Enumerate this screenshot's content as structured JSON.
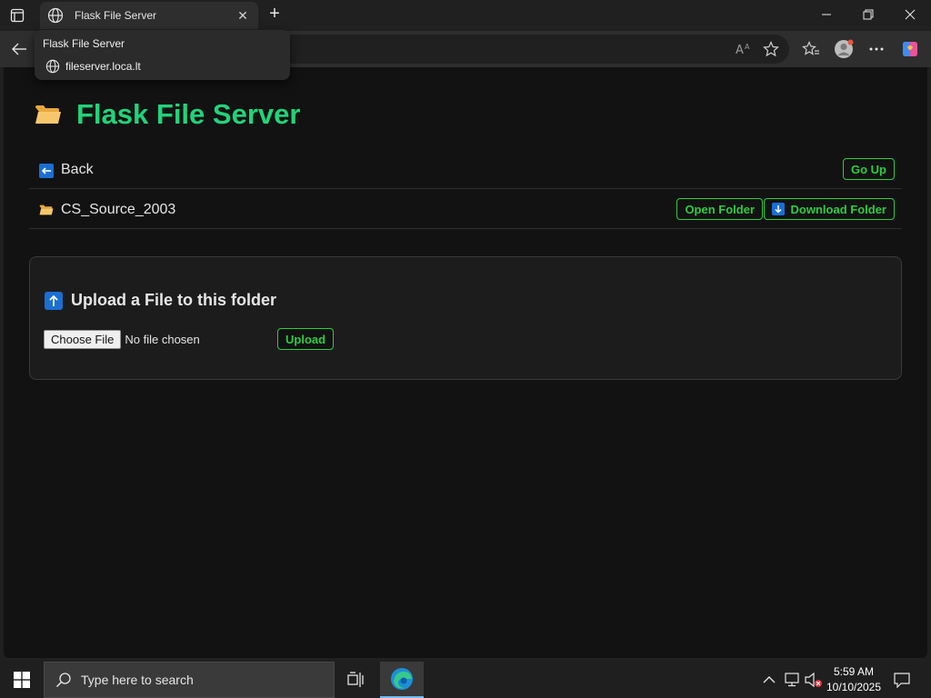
{
  "browser": {
    "tab_title": "Flask File Server",
    "tab_close": "✕",
    "new_tab": "+",
    "tooltip": {
      "title": "Flask File Server",
      "url": "fileserver.loca.lt"
    }
  },
  "page": {
    "title": "Flask File Server",
    "back_label": "Back",
    "go_up_label": "Go Up",
    "folder": {
      "name": "CS_Source_2003",
      "open_label": "Open Folder",
      "download_label": "Download Folder"
    },
    "upload": {
      "heading": "Upload a File to this folder",
      "choose_label": "Choose File",
      "no_file_text": "No file chosen",
      "upload_label": "Upload"
    },
    "accent_color": "#21d37a",
    "button_color": "#2ecc40"
  },
  "taskbar": {
    "search_placeholder": "Type here to search",
    "time": "5:59 AM",
    "date": "10/10/2025"
  }
}
